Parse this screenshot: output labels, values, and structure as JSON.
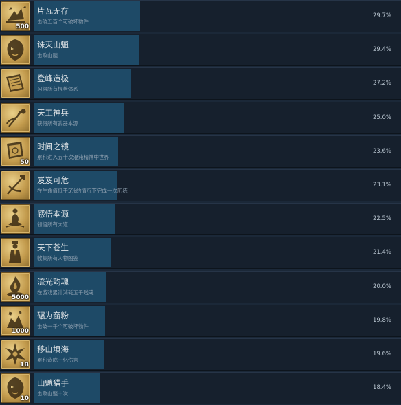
{
  "colors": {
    "background": "#1b2838",
    "row_background": "#16202d",
    "progress_fill": "#1e4a67",
    "icon_gold": "#c29a4c",
    "title_text": "#dfe3e6",
    "description_text": "#8fa0b0"
  },
  "achievements": [
    {
      "title": "片瓦无存",
      "description": "击破五百个可破坏物件",
      "percent": "29.7%",
      "fill": 0.297,
      "icon": "broken-tiles-icon",
      "badge": "500"
    },
    {
      "title": "诛灭山魈",
      "description": "击败山魈",
      "percent": "29.4%",
      "fill": 0.294,
      "icon": "beast-head-icon",
      "badge": ""
    },
    {
      "title": "登峰造极",
      "description": "习得所有棍势体系",
      "percent": "27.2%",
      "fill": 0.272,
      "icon": "scroll-book-icon",
      "badge": ""
    },
    {
      "title": "天工神兵",
      "description": "获得所有武器本源",
      "percent": "25.0%",
      "fill": 0.25,
      "icon": "dragon-weapon-icon",
      "badge": ""
    },
    {
      "title": "时间之镜",
      "description": "累积进入五十次混沌精神中世界",
      "percent": "23.6%",
      "fill": 0.236,
      "icon": "time-mirror-icon",
      "badge": "50"
    },
    {
      "title": "岌岌可危",
      "description": "在生命值低于5%的情况下完成一次历练",
      "percent": "23.1%",
      "fill": 0.231,
      "icon": "staff-danger-icon",
      "badge": ""
    },
    {
      "title": "感悟本源",
      "description": "领悟所有大道",
      "percent": "22.5%",
      "fill": 0.225,
      "icon": "meditation-icon",
      "badge": ""
    },
    {
      "title": "天下苍生",
      "description": "收集所有人物图鉴",
      "percent": "21.4%",
      "fill": 0.214,
      "icon": "scholar-figure-icon",
      "badge": ""
    },
    {
      "title": "流光韵魂",
      "description": "在游戏累计消耗五千残魂",
      "percent": "20.0%",
      "fill": 0.2,
      "icon": "soul-flame-icon",
      "badge": "5000"
    },
    {
      "title": "碾为齑粉",
      "description": "击破一千个可破坏物件",
      "percent": "19.8%",
      "fill": 0.198,
      "icon": "crumbling-pile-icon",
      "badge": "1000"
    },
    {
      "title": "移山填海",
      "description": "累积造成一亿伤害",
      "percent": "19.6%",
      "fill": 0.196,
      "icon": "burst-strike-icon",
      "badge": "1B"
    },
    {
      "title": "山魈猎手",
      "description": "击败山魈十次",
      "percent": "18.4%",
      "fill": 0.184,
      "icon": "beast-head-icon",
      "badge": "10"
    }
  ]
}
